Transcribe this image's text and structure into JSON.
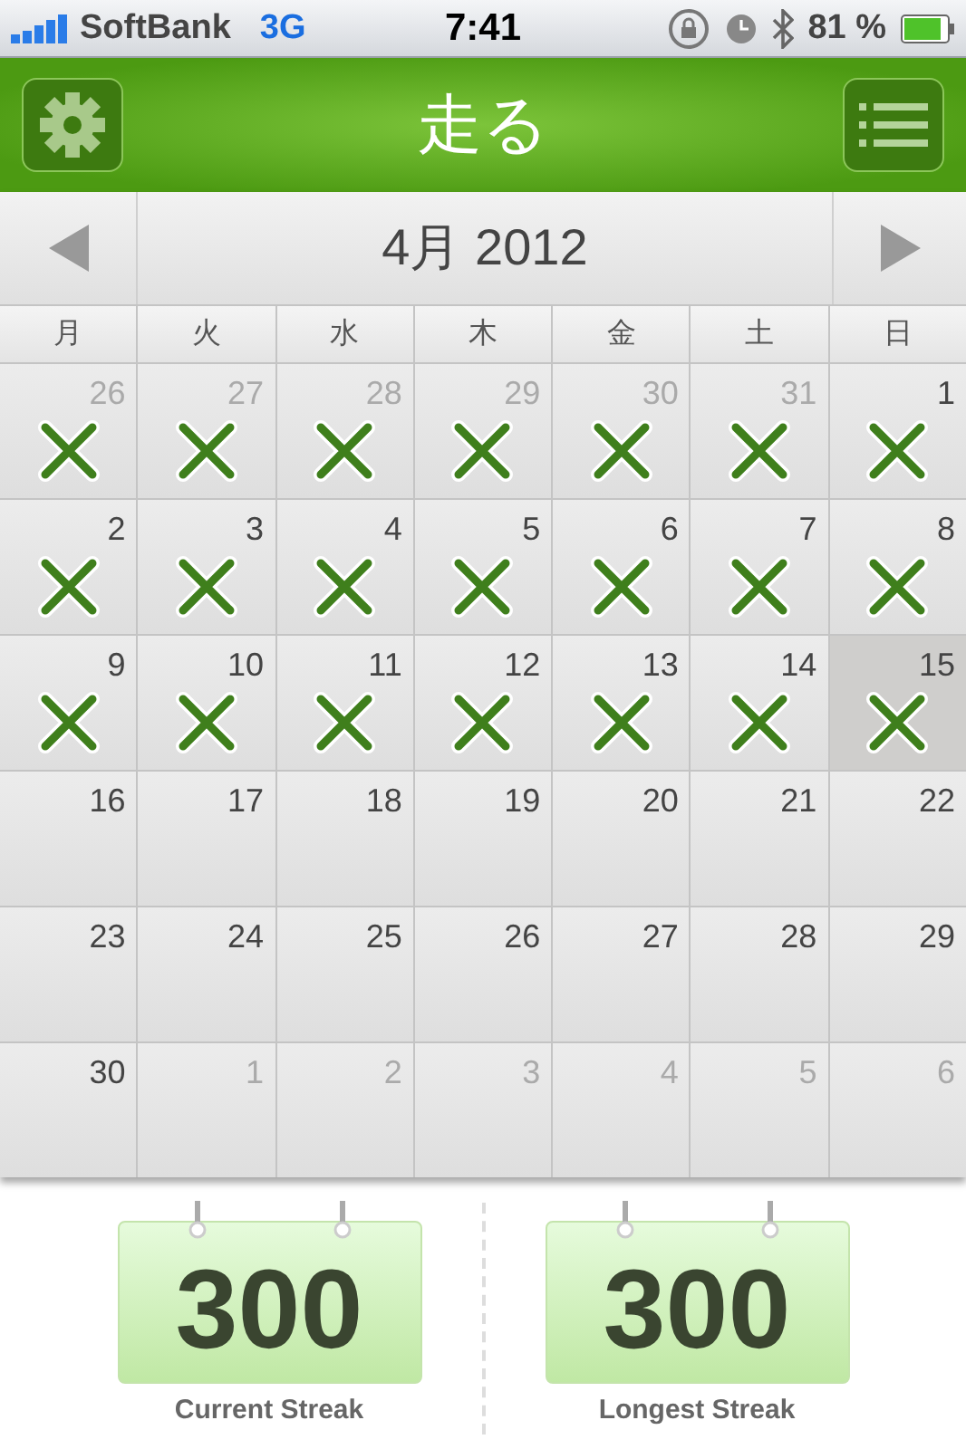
{
  "status_bar": {
    "carrier": "SoftBank",
    "network": "3G",
    "time": "7:41",
    "battery": "81 %"
  },
  "header": {
    "title": "走る"
  },
  "calendar": {
    "month": "4月 2012",
    "weekdays": [
      "月",
      "火",
      "水",
      "木",
      "金",
      "土",
      "日"
    ],
    "days": [
      {
        "day": "26",
        "current_month": false,
        "marked": true,
        "selected": false
      },
      {
        "day": "27",
        "current_month": false,
        "marked": true,
        "selected": false
      },
      {
        "day": "28",
        "current_month": false,
        "marked": true,
        "selected": false
      },
      {
        "day": "29",
        "current_month": false,
        "marked": true,
        "selected": false
      },
      {
        "day": "30",
        "current_month": false,
        "marked": true,
        "selected": false
      },
      {
        "day": "31",
        "current_month": false,
        "marked": true,
        "selected": false
      },
      {
        "day": "1",
        "current_month": true,
        "marked": true,
        "selected": false
      },
      {
        "day": "2",
        "current_month": true,
        "marked": true,
        "selected": false
      },
      {
        "day": "3",
        "current_month": true,
        "marked": true,
        "selected": false
      },
      {
        "day": "4",
        "current_month": true,
        "marked": true,
        "selected": false
      },
      {
        "day": "5",
        "current_month": true,
        "marked": true,
        "selected": false
      },
      {
        "day": "6",
        "current_month": true,
        "marked": true,
        "selected": false
      },
      {
        "day": "7",
        "current_month": true,
        "marked": true,
        "selected": false
      },
      {
        "day": "8",
        "current_month": true,
        "marked": true,
        "selected": false
      },
      {
        "day": "9",
        "current_month": true,
        "marked": true,
        "selected": false
      },
      {
        "day": "10",
        "current_month": true,
        "marked": true,
        "selected": false
      },
      {
        "day": "11",
        "current_month": true,
        "marked": true,
        "selected": false
      },
      {
        "day": "12",
        "current_month": true,
        "marked": true,
        "selected": false
      },
      {
        "day": "13",
        "current_month": true,
        "marked": true,
        "selected": false
      },
      {
        "day": "14",
        "current_month": true,
        "marked": true,
        "selected": false
      },
      {
        "day": "15",
        "current_month": true,
        "marked": true,
        "selected": true
      },
      {
        "day": "16",
        "current_month": true,
        "marked": false,
        "selected": false
      },
      {
        "day": "17",
        "current_month": true,
        "marked": false,
        "selected": false
      },
      {
        "day": "18",
        "current_month": true,
        "marked": false,
        "selected": false
      },
      {
        "day": "19",
        "current_month": true,
        "marked": false,
        "selected": false
      },
      {
        "day": "20",
        "current_month": true,
        "marked": false,
        "selected": false
      },
      {
        "day": "21",
        "current_month": true,
        "marked": false,
        "selected": false
      },
      {
        "day": "22",
        "current_month": true,
        "marked": false,
        "selected": false
      },
      {
        "day": "23",
        "current_month": true,
        "marked": false,
        "selected": false
      },
      {
        "day": "24",
        "current_month": true,
        "marked": false,
        "selected": false
      },
      {
        "day": "25",
        "current_month": true,
        "marked": false,
        "selected": false
      },
      {
        "day": "26",
        "current_month": true,
        "marked": false,
        "selected": false
      },
      {
        "day": "27",
        "current_month": true,
        "marked": false,
        "selected": false
      },
      {
        "day": "28",
        "current_month": true,
        "marked": false,
        "selected": false
      },
      {
        "day": "29",
        "current_month": true,
        "marked": false,
        "selected": false
      },
      {
        "day": "30",
        "current_month": true,
        "marked": false,
        "selected": false
      },
      {
        "day": "1",
        "current_month": false,
        "marked": false,
        "selected": false
      },
      {
        "day": "2",
        "current_month": false,
        "marked": false,
        "selected": false
      },
      {
        "day": "3",
        "current_month": false,
        "marked": false,
        "selected": false
      },
      {
        "day": "4",
        "current_month": false,
        "marked": false,
        "selected": false
      },
      {
        "day": "5",
        "current_month": false,
        "marked": false,
        "selected": false
      },
      {
        "day": "6",
        "current_month": false,
        "marked": false,
        "selected": false
      }
    ]
  },
  "streaks": [
    {
      "value": "300",
      "label": "Current Streak"
    },
    {
      "value": "300",
      "label": "Longest Streak"
    }
  ]
}
